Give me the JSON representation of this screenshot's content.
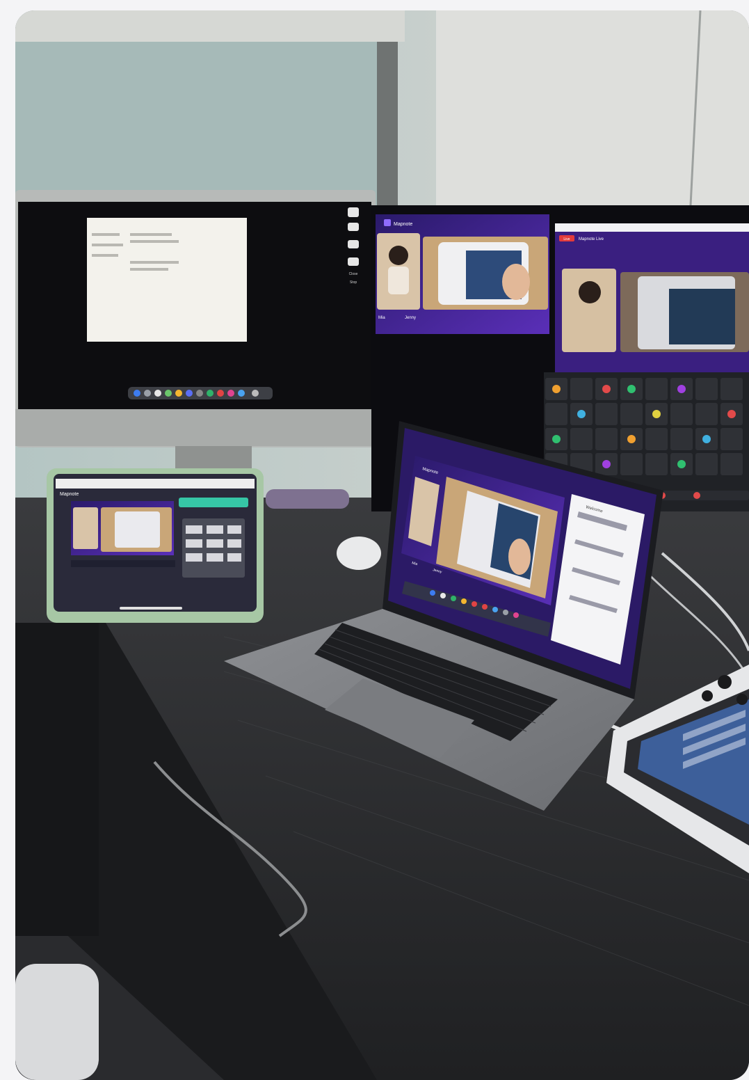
{
  "scene": {
    "type": "photo",
    "colors": {
      "wall": "#c9cdc8",
      "window_glass": "#a9bdbc",
      "desk": "#2c2d30",
      "monitor_silver": "#b8bbb9",
      "stream_purple": "#3b1f7a",
      "stream_accent": "#6a3bdc",
      "ipad_case_green": "#a7c7a5"
    }
  },
  "imac": {
    "sidebar_buttons": [
      "Close",
      "Stop"
    ]
  },
  "stream_monitor": {
    "brand": "Mapnote",
    "names": [
      "Mia",
      "Jenny"
    ],
    "page_title": "Mapnote Live",
    "badge": "Live"
  },
  "laptop": {
    "brand": "Mapnote",
    "panel_title": "Welcome",
    "names": [
      "Mia",
      "Jenny"
    ]
  },
  "ipad": {
    "app_name": "Mapnote"
  }
}
